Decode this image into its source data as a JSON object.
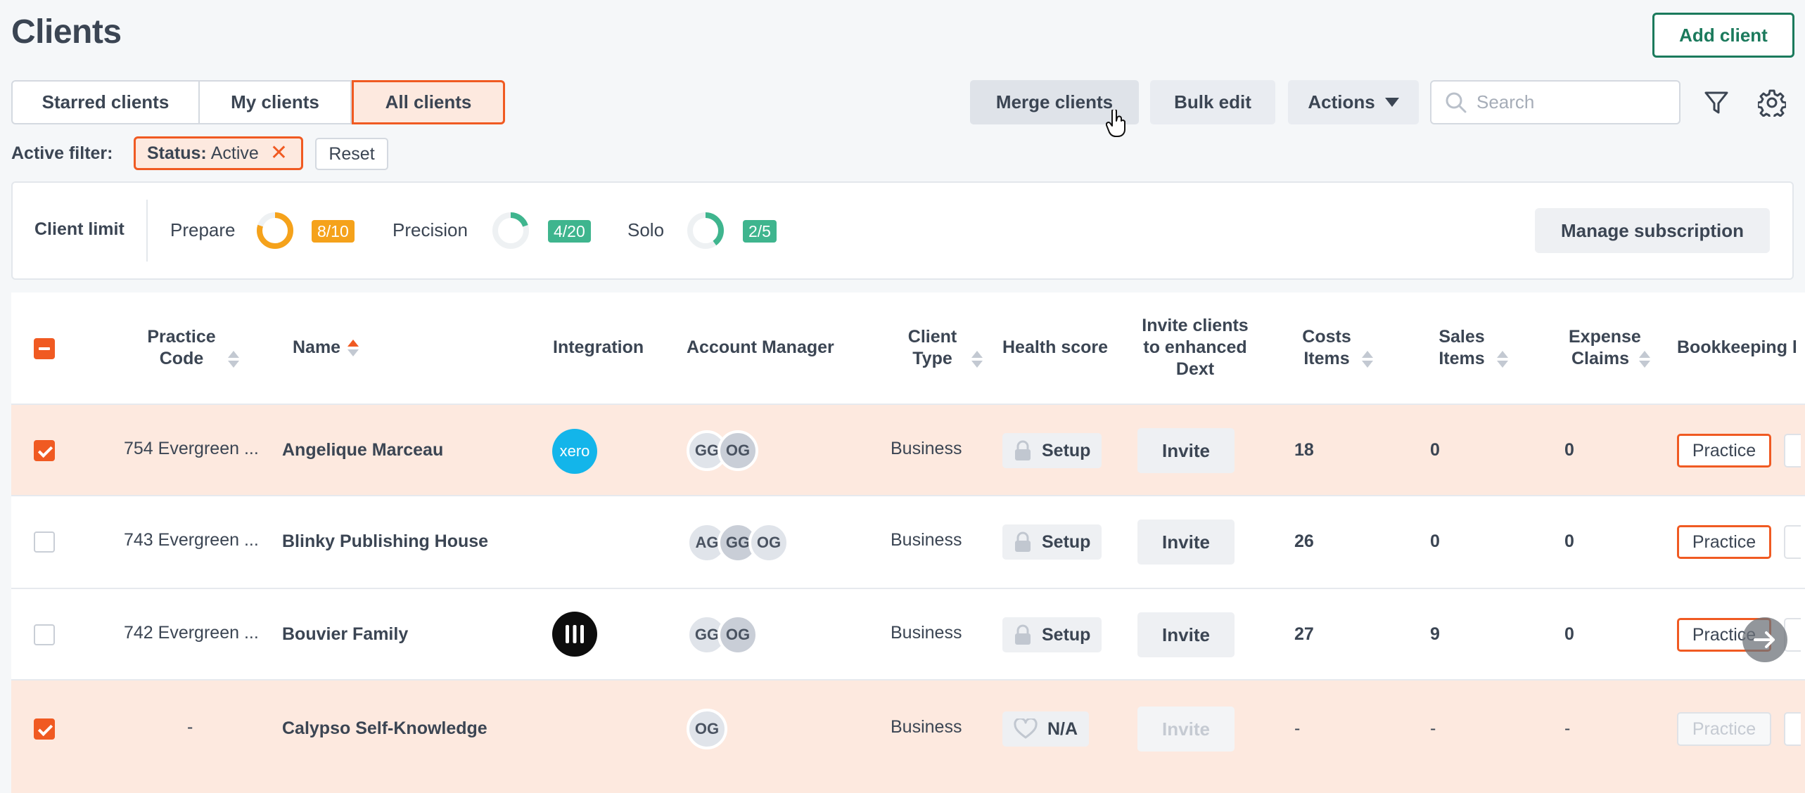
{
  "page": {
    "title": "Clients",
    "add_client_label": "Add client"
  },
  "tabs": [
    {
      "label": "Starred clients",
      "active": false
    },
    {
      "label": "My clients",
      "active": false
    },
    {
      "label": "All clients",
      "active": true
    }
  ],
  "toolbar": {
    "merge_label": "Merge clients",
    "bulk_edit_label": "Bulk edit",
    "actions_label": "Actions",
    "search_placeholder": "Search"
  },
  "filter": {
    "label": "Active filter:",
    "chip_key": "Status:",
    "chip_value": "Active",
    "reset_label": "Reset"
  },
  "limits": {
    "title": "Client limit",
    "items": [
      {
        "label": "Prepare",
        "used": 8,
        "total": 10,
        "badge": "8/10",
        "color": "#f5a21b"
      },
      {
        "label": "Precision",
        "used": 4,
        "total": 20,
        "badge": "4/20",
        "color": "#3fb58e"
      },
      {
        "label": "Solo",
        "used": 2,
        "total": 5,
        "badge": "2/5",
        "color": "#3fb58e"
      }
    ],
    "manage_label": "Manage subscription"
  },
  "table": {
    "headers": {
      "practice_code": "Practice Code",
      "name": "Name",
      "integration": "Integration",
      "account_manager": "Account Manager",
      "client_type": "Client Type",
      "health_score": "Health score",
      "invite": "Invite clients to enhanced Dext",
      "costs": "Costs Items",
      "sales": "Sales Items",
      "expense": "Expense Claims",
      "bookkeeping": "Bookkeeping l"
    },
    "rows": [
      {
        "selected": true,
        "code": "754 Evergreen ...",
        "name": "Angelique Marceau",
        "integration": "xero",
        "managers": [
          "GG",
          "OG"
        ],
        "type": "Business",
        "health": "Setup",
        "invite": "Invite",
        "costs": "18",
        "sales": "0",
        "expense": "0",
        "bookkeeping": "Practice"
      },
      {
        "selected": false,
        "code": "743 Evergreen ...",
        "name": "Blinky Publishing House",
        "integration": "",
        "managers": [
          "AG",
          "GG",
          "OG"
        ],
        "type": "Business",
        "health": "Setup",
        "invite": "Invite",
        "costs": "26",
        "sales": "0",
        "expense": "0",
        "bookkeeping": "Practice"
      },
      {
        "selected": false,
        "code": "742 Evergreen ...",
        "name": "Bouvier Family",
        "integration": "other",
        "managers": [
          "GG",
          "OG"
        ],
        "type": "Business",
        "health": "Setup",
        "invite": "Invite",
        "costs": "27",
        "sales": "9",
        "expense": "0",
        "bookkeeping": "Practice"
      },
      {
        "selected": true,
        "code": "-",
        "name": "Calypso Self-Knowledge",
        "integration": "",
        "managers": [
          "OG"
        ],
        "type": "Business",
        "health": "N/A",
        "invite": "Invite",
        "costs": "-",
        "sales": "-",
        "expense": "-",
        "bookkeeping": "Practice"
      }
    ],
    "integration_text": "xero"
  },
  "colors": {
    "accent": "#f05a22",
    "brand_green": "#1b7a5c",
    "selected_row": "#fde9df",
    "xero": "#13b5ea"
  }
}
